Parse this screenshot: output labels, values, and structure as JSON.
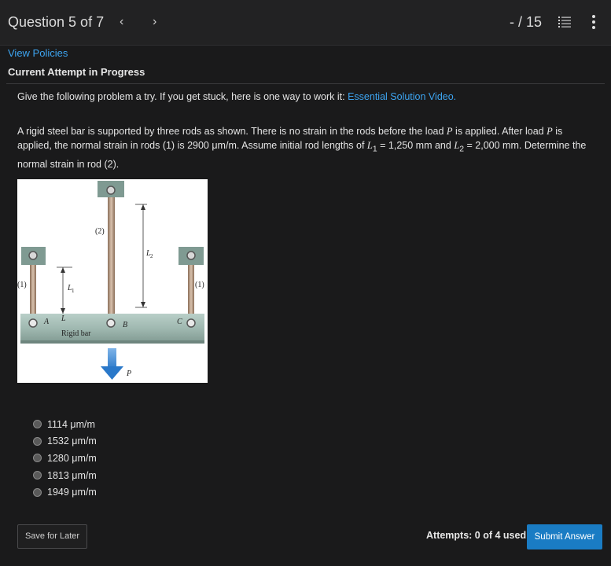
{
  "header": {
    "question_label": "Question 5 of 7",
    "prev_icon": "‹",
    "next_icon": "›",
    "score": "- / 15"
  },
  "links": {
    "view_policies": "View Policies"
  },
  "attempt_status": "Current Attempt in Progress",
  "intro": {
    "text": "Give the following problem a try.  If you get stuck, here is one way to work it: ",
    "link": "Essential Solution Video."
  },
  "problem": {
    "p1": "A rigid steel bar is supported by three rods as shown. There is no strain in the rods before the load ",
    "p_var1": "P",
    "p2": " is applied. After load ",
    "p_var2": "P",
    "p3": " is applied, the normal strain in rods (1) is 2900 μm/m. Assume initial rod lengths of ",
    "l1_var": "L",
    "l1_sub": "1",
    "p4": " = 1,250 mm and ",
    "l2_var": "L",
    "l2_sub": "2",
    "p5": " = 2,000 mm. Determine the normal strain in rod (2)."
  },
  "figure": {
    "rod1_left_label": "(1)",
    "rod1_right_label": "(1)",
    "rod2_label": "(2)",
    "l1_label": "L",
    "l1_sub": "1",
    "l2_label": "L",
    "l2_sub": "2",
    "point_a": "A",
    "point_b": "B",
    "point_c": "C",
    "bar_label": "Rigid bar",
    "load_label": "P"
  },
  "options": [
    {
      "label": "1114 μm/m"
    },
    {
      "label": "1532 μm/m"
    },
    {
      "label": "1280 μm/m"
    },
    {
      "label": "1813 μm/m"
    },
    {
      "label": "1949 μm/m"
    }
  ],
  "footer": {
    "save_label": "Save for Later",
    "attempts_label": "Attempts: 0 of 4 used",
    "submit_label": "Submit Answer"
  },
  "colors": {
    "link": "#3da4f0",
    "submit_bg": "#1a7cc4",
    "page_bg": "#1a1a1b"
  }
}
